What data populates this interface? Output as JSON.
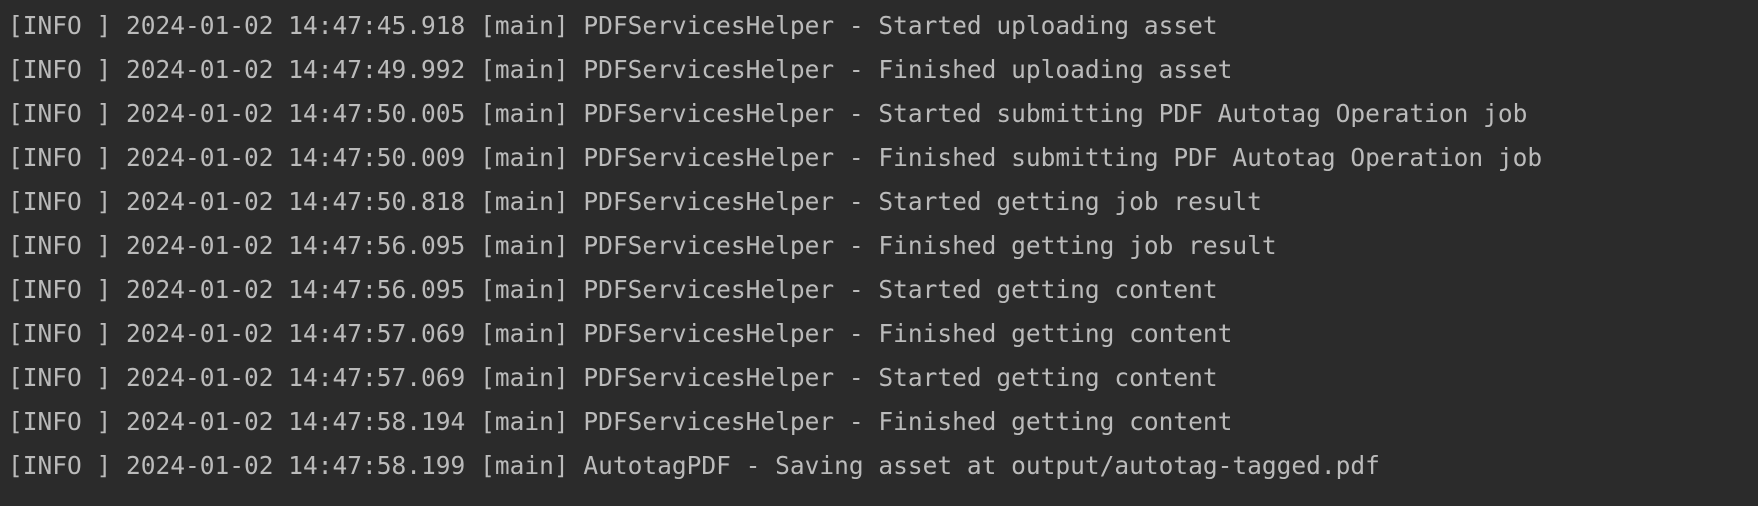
{
  "console": {
    "lines": [
      {
        "level": "[INFO ]",
        "timestamp": "2024-01-02 14:47:45.918",
        "thread": "[main]",
        "logger": "PDFServicesHelper",
        "separator": "-",
        "message": "Started uploading asset"
      },
      {
        "level": "[INFO ]",
        "timestamp": "2024-01-02 14:47:49.992",
        "thread": "[main]",
        "logger": "PDFServicesHelper",
        "separator": "-",
        "message": "Finished uploading asset"
      },
      {
        "level": "[INFO ]",
        "timestamp": "2024-01-02 14:47:50.005",
        "thread": "[main]",
        "logger": "PDFServicesHelper",
        "separator": "-",
        "message": "Started submitting PDF Autotag Operation job"
      },
      {
        "level": "[INFO ]",
        "timestamp": "2024-01-02 14:47:50.009",
        "thread": "[main]",
        "logger": "PDFServicesHelper",
        "separator": "-",
        "message": "Finished submitting PDF Autotag Operation job"
      },
      {
        "level": "[INFO ]",
        "timestamp": "2024-01-02 14:47:50.818",
        "thread": "[main]",
        "logger": "PDFServicesHelper",
        "separator": "-",
        "message": "Started getting job result"
      },
      {
        "level": "[INFO ]",
        "timestamp": "2024-01-02 14:47:56.095",
        "thread": "[main]",
        "logger": "PDFServicesHelper",
        "separator": "-",
        "message": "Finished getting job result"
      },
      {
        "level": "[INFO ]",
        "timestamp": "2024-01-02 14:47:56.095",
        "thread": "[main]",
        "logger": "PDFServicesHelper",
        "separator": "-",
        "message": "Started getting content"
      },
      {
        "level": "[INFO ]",
        "timestamp": "2024-01-02 14:47:57.069",
        "thread": "[main]",
        "logger": "PDFServicesHelper",
        "separator": "-",
        "message": "Finished getting content"
      },
      {
        "level": "[INFO ]",
        "timestamp": "2024-01-02 14:47:57.069",
        "thread": "[main]",
        "logger": "PDFServicesHelper",
        "separator": "-",
        "message": "Started getting content"
      },
      {
        "level": "[INFO ]",
        "timestamp": "2024-01-02 14:47:58.194",
        "thread": "[main]",
        "logger": "PDFServicesHelper",
        "separator": "-",
        "message": "Finished getting content"
      },
      {
        "level": "[INFO ]",
        "timestamp": "2024-01-02 14:47:58.199",
        "thread": "[main]",
        "logger": "AutotagPDF",
        "separator": "-",
        "message": "Saving asset at output/autotag-tagged.pdf"
      }
    ]
  },
  "colors": {
    "background": "#2b2b2b",
    "text": "#bbbbbb"
  }
}
